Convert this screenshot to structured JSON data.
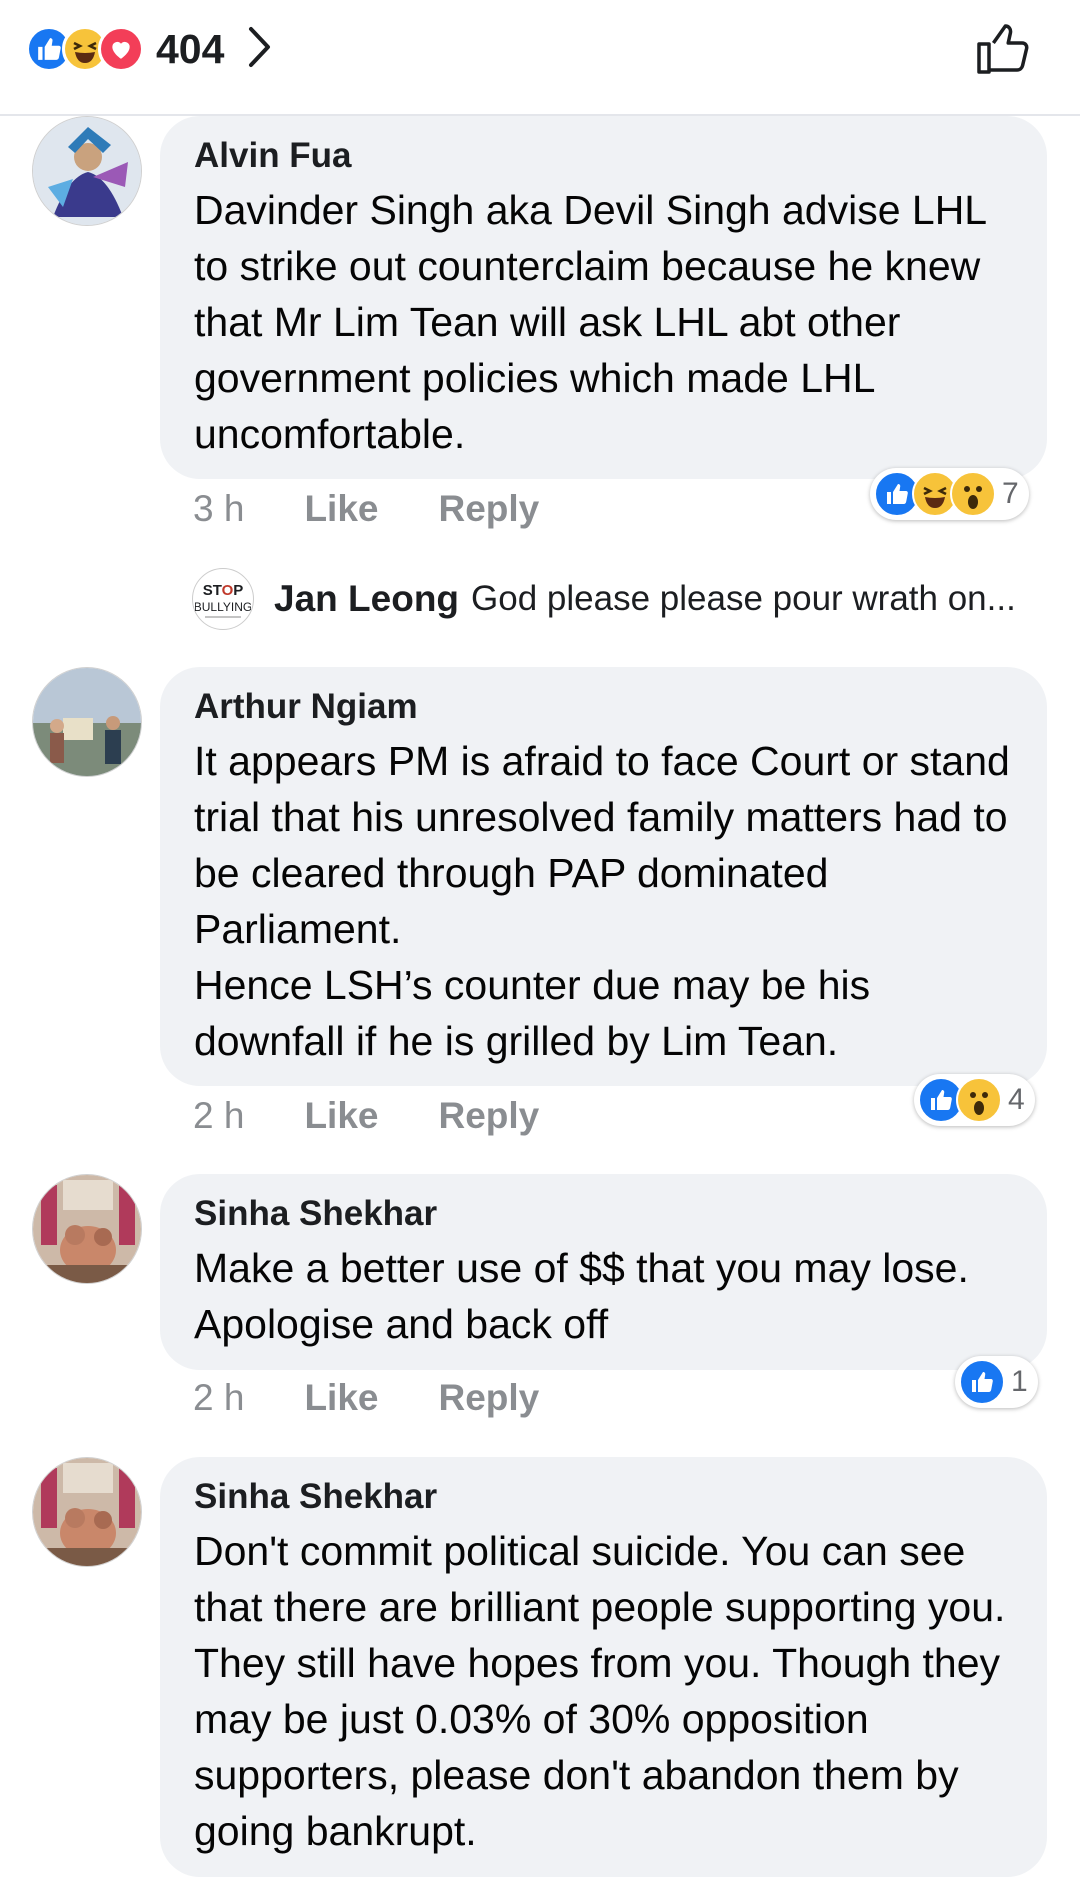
{
  "header": {
    "reaction_count": "404",
    "reaction_icons": [
      "like-icon",
      "haha-icon",
      "love-icon"
    ]
  },
  "comments": [
    {
      "author": "Alvin Fua",
      "text": "Davinder Singh aka Devil Singh advise LHL to strike out counterclaim because he knew that Mr Lim Tean will ask LHL abt other government policies which made LHL uncomfortable.",
      "time": "3 h",
      "like_label": "Like",
      "reply_label": "Reply",
      "reaction_count": "7",
      "reaction_icons": [
        "like-icon",
        "haha-icon",
        "wow-icon"
      ]
    },
    {
      "author": "Arthur Ngiam",
      "text": "It appears PM is afraid to face Court or stand trial that his unresolved family matters had to be cleared through PAP dominated Parliament.\nHence LSH’s counter due may be his downfall if he is grilled by Lim Tean.",
      "time": "2 h",
      "like_label": "Like",
      "reply_label": "Reply",
      "reaction_count": "4",
      "reaction_icons": [
        "like-icon",
        "wow-icon"
      ]
    },
    {
      "author": "Sinha Shekhar",
      "text": "Make a better use of $$ that you may lose. Apologise and back off",
      "time": "2 h",
      "like_label": "Like",
      "reply_label": "Reply",
      "reaction_count": "1",
      "reaction_icons": [
        "like-icon"
      ]
    },
    {
      "author": "Sinha Shekhar",
      "text": "Don't commit political suicide. You can see that there are brilliant people supporting you. They still have hopes from you. Though they may be just 0.03% of 30% opposition supporters, please don't abandon them by going bankrupt."
    }
  ],
  "reply_preview": {
    "author": "Jan Leong",
    "snippet": "God please please pour wrath on...",
    "avatar_text": "STOP BULLYING"
  },
  "colors": {
    "like": "#1877f2",
    "haha": "#f7c33a",
    "love": "#f33e58",
    "bubble": "#f0f2f5",
    "meta_text": "#8a8d91"
  }
}
